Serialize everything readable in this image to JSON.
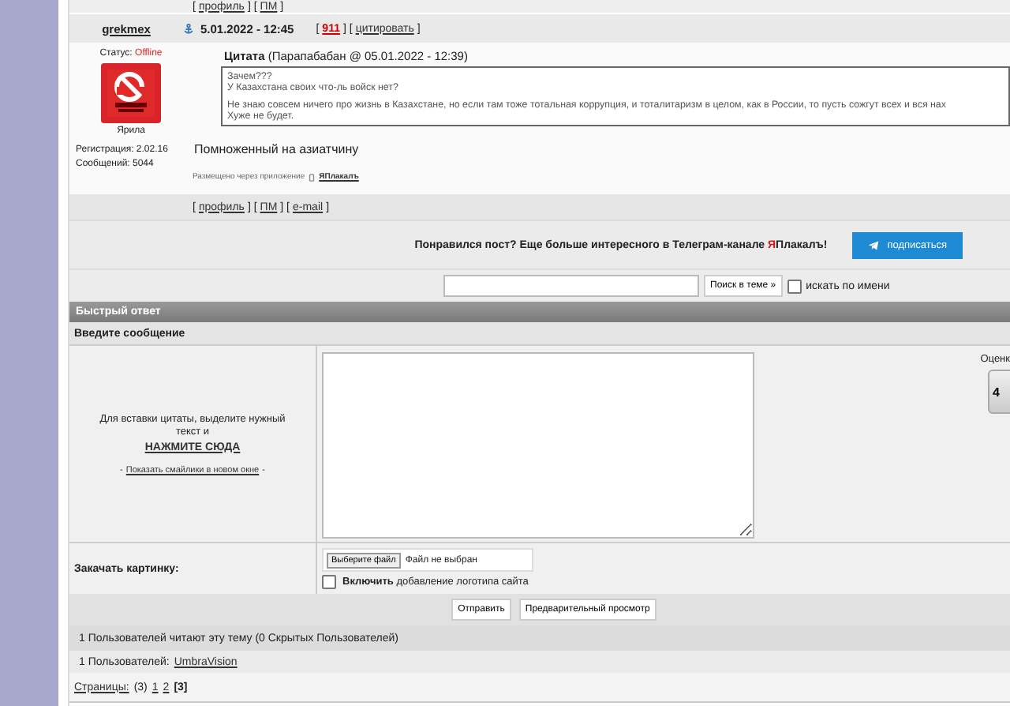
{
  "prev_post_links": [
    {
      "text": "[",
      "kind": "plain"
    },
    {
      "text": "профиль",
      "kind": "link"
    },
    {
      "text": "] [",
      "kind": "plain"
    },
    {
      "text": "ПМ",
      "kind": "link"
    },
    {
      "text": "]",
      "kind": "plain"
    }
  ],
  "post": {
    "author": "grekmex",
    "date": "5.01.2022 - 12:45",
    "actions": [
      {
        "text": "[",
        "kind": "plain"
      },
      {
        "text": "911",
        "kind": "rating"
      },
      {
        "text": "] [",
        "kind": "plain"
      },
      {
        "text": "цитировать",
        "kind": "link"
      },
      {
        "text": "]",
        "kind": "plain"
      }
    ],
    "status_label": "Статус:",
    "status": "Offline",
    "rank": "Ярила",
    "registration": "Регистрация: 2.02.16",
    "messages": "Сообщений: 5044",
    "quote": {
      "title": "Цитата",
      "meta": "(Парапабабан @ 05.01.2022 - 12:39)",
      "paragraphs": [
        [
          "Зачем???",
          "У Казахстана своих что-ль войск нет?"
        ],
        [
          "Не знаю совсем ничего про жизнь в Казахстане, но если там тоже тотальная коррупция, и тоталитаризм в целом, как в России, то пусть сожгут всех и вся нах",
          "Хуже не будет."
        ]
      ]
    },
    "text": "Помноженный на азиатчину",
    "via_label": "Размещено через приложение",
    "via_link": "ЯПлакалъ",
    "links": [
      {
        "text": "[",
        "kind": "plain"
      },
      {
        "text": "профиль",
        "kind": "link"
      },
      {
        "text": "] [",
        "kind": "plain"
      },
      {
        "text": "ПМ",
        "kind": "link"
      },
      {
        "text": "] [",
        "kind": "plain"
      },
      {
        "text": "e-mail",
        "kind": "link"
      },
      {
        "text": "]",
        "kind": "plain"
      }
    ]
  },
  "banner": {
    "text": "Понравился пост? Еще больше интересного в Телеграм-канале ",
    "brand_accent": "Я",
    "brand_rest": "Плакалъ!",
    "button": "подписаться"
  },
  "search": {
    "button": "Поиск в теме »",
    "by_name": {
      "label": "искать по имени",
      "checked": false
    }
  },
  "quick_reply": {
    "title": "Быстрый ответ",
    "prompt": "Введите сообщение",
    "hint": "Для вставки цитаты, выделите нужный текст и",
    "hint_link": "НАЖМИТЕ СЮДА",
    "smilies_pre": "-",
    "smilies_link": "Показать смайлики в новом окне",
    "smilies_post": "-",
    "rating_label": "Оценк",
    "rating_value": "4",
    "upload_label": "Закачать картинку:",
    "file_button": "Выберите файл",
    "file_status": "Файл не выбран",
    "logo": {
      "label": "**Включить** добавление логотипа сайта",
      "checked": false
    },
    "buttons": [
      "Отправить",
      "Предварительный просмотр"
    ]
  },
  "readers": {
    "summary": "1 Пользователей читают эту тему (0 Скрытых Пользователей)",
    "users_label": "1 Пользователей:",
    "users": [
      "UmbraVision"
    ]
  },
  "pages": {
    "label": "Страницы:",
    "count": "(3)",
    "items": [
      {
        "text": "1",
        "selected": false
      },
      {
        "text": "2",
        "selected": false
      },
      {
        "text": "[3]",
        "selected": true
      }
    ]
  }
}
